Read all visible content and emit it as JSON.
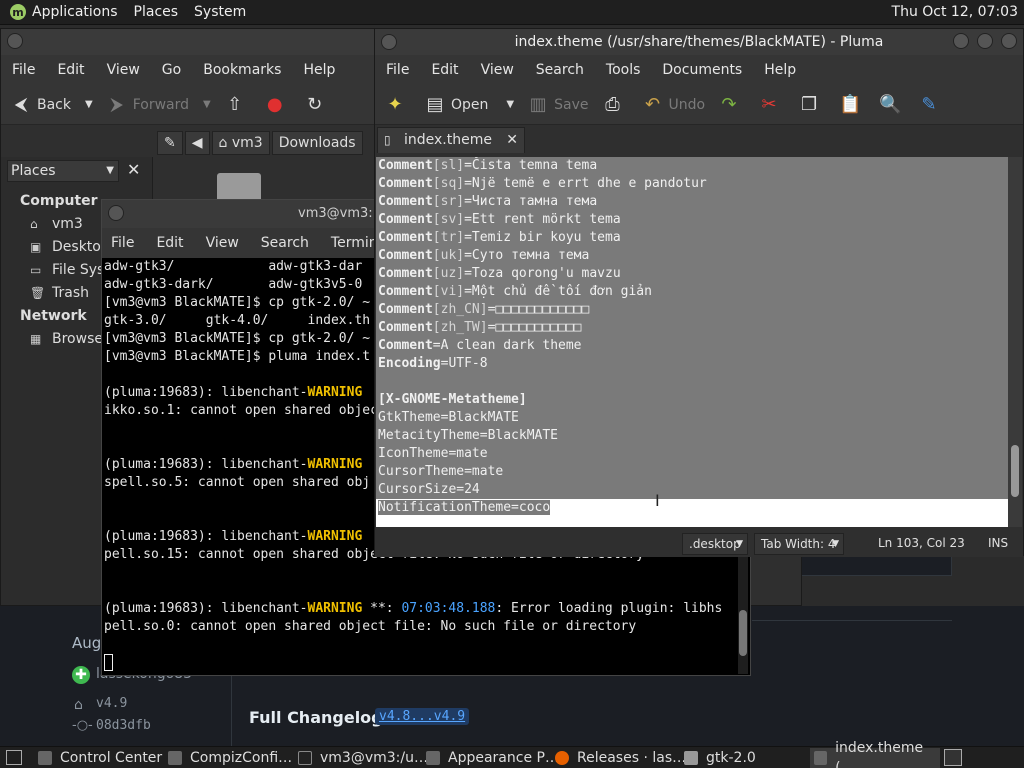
{
  "top_panel": {
    "menus": [
      "Applications",
      "Places",
      "System"
    ],
    "clock": "Thu Oct 12, 07:03"
  },
  "caja": {
    "menus": [
      "File",
      "Edit",
      "View",
      "Go",
      "Bookmarks",
      "Help"
    ],
    "toolbar": {
      "back": "Back",
      "forward": "Forward"
    },
    "places_combo": "Places",
    "sidebar": {
      "computer": "Computer",
      "items": [
        "vm3",
        "Desktop",
        "File Syst",
        "Trash"
      ],
      "network": "Network",
      "browse": "Browse N"
    },
    "path": [
      "vm3",
      "Downloads"
    ]
  },
  "terminal": {
    "title": "vm3@vm3:",
    "menus": [
      "File",
      "Edit",
      "View",
      "Search",
      "Terminal"
    ],
    "lines": [
      [
        "adw-gtk3/            adw-gtk3-dar"
      ],
      [
        "adw-gtk3-dark/       adw-gtk3v5-0"
      ],
      [
        "[vm3@vm3 BlackMATE]$ cp gtk-2.0/ ~"
      ],
      [
        "gtk-3.0/     gtk-4.0/     index.th"
      ],
      [
        "[vm3@vm3 BlackMATE]$ cp gtk-2.0/ ~"
      ],
      [
        "[vm3@vm3 BlackMATE]$ pluma index.t"
      ],
      [
        ""
      ],
      [
        "(pluma:19683): libenchant-",
        "WARNING"
      ],
      [
        "ikko.so.1: cannot open shared object"
      ],
      [
        ""
      ],
      [
        ""
      ],
      [
        "(pluma:19683): libenchant-",
        "WARNING"
      ],
      [
        "spell.so.5: cannot open shared obj"
      ],
      [
        ""
      ],
      [
        ""
      ],
      [
        "(pluma:19683): libenchant-",
        "WARNING"
      ],
      [
        "pell.so.15: cannot open shared object file: No such file or directory"
      ],
      [
        ""
      ],
      [
        ""
      ],
      [
        "(pluma:19683): libenchant-",
        "WARNING",
        " **: ",
        "07:03:48.188",
        ": Error loading plugin: libhs"
      ],
      [
        "pell.so.0: cannot open shared object file: No such file or directory"
      ]
    ]
  },
  "pluma": {
    "title": "index.theme (/usr/share/themes/BlackMATE) - Pluma",
    "menus": [
      "File",
      "Edit",
      "View",
      "Search",
      "Tools",
      "Documents",
      "Help"
    ],
    "toolbar": {
      "open": "Open",
      "save": "Save",
      "undo": "Undo"
    },
    "tab": "index.theme",
    "editor_lines": [
      [
        "Comment",
        "[sl]",
        "=Čista temna tema"
      ],
      [
        "Comment",
        "[sq]",
        "=Një temë e errt dhe e pandotur"
      ],
      [
        "Comment",
        "[sr]",
        "=Чиста тамна тема"
      ],
      [
        "Comment",
        "[sv]",
        "=Ett rent mörkt tema"
      ],
      [
        "Comment",
        "[tr]",
        "=Temiz bir koyu tema"
      ],
      [
        "Comment",
        "[uk]",
        "=Суто темна тема"
      ],
      [
        "Comment",
        "[uz]",
        "=Toza qorong'u mavzu"
      ],
      [
        "Comment",
        "[vi]",
        "=Một chủ đề tối đơn giản"
      ],
      [
        "Comment",
        "[zh_CN]",
        "=□□□□□□□□□□□□"
      ],
      [
        "Comment",
        "[zh_TW]",
        "=□□□□□□□□□□□"
      ],
      [
        "Comment",
        "",
        "=A clean dark theme"
      ],
      [
        "Encoding",
        "",
        "=UTF-8"
      ],
      [
        "",
        "",
        ""
      ],
      [
        "[X-GNOME-Metatheme]",
        "",
        ""
      ],
      [
        "",
        "",
        "GtkTheme=BlackMATE"
      ],
      [
        "",
        "",
        "MetacityTheme=BlackMATE"
      ],
      [
        "",
        "",
        "IconTheme=mate"
      ],
      [
        "",
        "",
        "CursorTheme=mate"
      ],
      [
        "",
        "",
        "CursorSize=24"
      ],
      [
        "",
        "",
        "NotificationTheme=coco"
      ]
    ],
    "status": {
      "language": ".desktop",
      "tab_width": "Tab Width:  4",
      "position": "Ln 103, Col 23",
      "mode": "INS"
    }
  },
  "web": {
    "date_prefix": "Aug",
    "author": "lassekongo83",
    "tag": "v4.9",
    "commit": "08d3dfb",
    "changelog_title": "Full Changelog:",
    "changelog_link": "v4.8...v4.9"
  },
  "taskbar": {
    "items": [
      "Control Center",
      "CompizConfi…",
      "vm3@vm3:/u…",
      "Appearance P…",
      "Releases · las…",
      "gtk-2.0",
      "index.theme (…"
    ]
  }
}
